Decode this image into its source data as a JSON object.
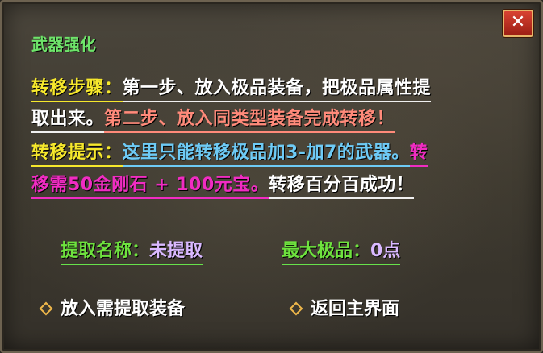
{
  "title": "武器强化",
  "close_label": "✕",
  "info": {
    "line1_label": "转移步骤：",
    "line1_text": "第一步、放入极品装备，把极品属性提",
    "line2_text_a": "取出来。",
    "line2_text_b": "第二步、放入同类型装备完成转移！",
    "line3_label": "转移提示：",
    "line3_text_a": "这里只能转移极品加3-加7的武器。",
    "line3_text_b": "转",
    "line4_text_a": "移需50金刚石 + 100元宝。",
    "line4_text_b": "转移百分百成功！"
  },
  "stats": {
    "extract_name_label": "提取名称：",
    "extract_name_value": "未提取",
    "max_quality_label": "最大极品：",
    "max_quality_value": "0点"
  },
  "buttons": {
    "insert_label": "放入需提取装备",
    "return_label": "返回主界面"
  },
  "colors": {
    "title": "#6ee46a",
    "yellow": "#f6e82c",
    "salmon": "#ff8a7a",
    "cyan": "#6ecbf6",
    "magenta": "#f02cc2",
    "diamond": "#f0b84a"
  },
  "icons": {
    "close": "close-icon",
    "bullet": "diamond-icon"
  }
}
